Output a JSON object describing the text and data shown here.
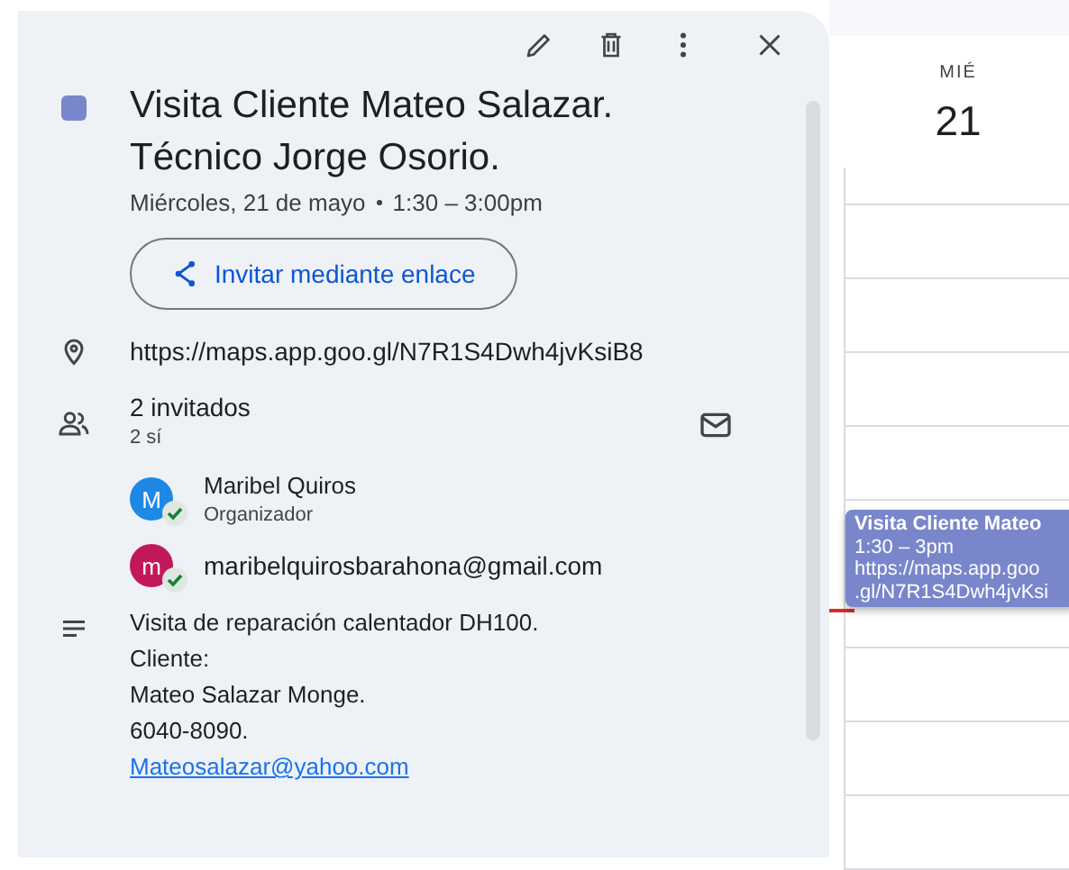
{
  "event": {
    "color": "#7986cb",
    "title_lines": [
      "Visita Cliente Mateo Salazar.",
      "Técnico Jorge Osorio."
    ],
    "date": "Miércoles, 21 de mayo",
    "time": "1:30 – 3:00pm",
    "invite_button": "Invitar mediante enlace",
    "location": "https://maps.app.goo.gl/N7R1S4Dwh4jvKsiB8",
    "guests_count": "2 invitados",
    "guests_yes": "2 sí",
    "guests": [
      {
        "avatar": "M",
        "color": "#1e88e5",
        "name": "Maribel Quiros",
        "role": "Organizador",
        "accepted": true
      },
      {
        "avatar": "m",
        "color": "#c2185b",
        "name": "maribelquirosbarahona@gmail.com",
        "accepted": true
      }
    ],
    "description": [
      "Visita de reparación calentador DH100.",
      "Cliente:",
      "Mateo Salazar Monge.",
      "6040-8090."
    ],
    "description_link": "Mateosalazar@yahoo.com"
  },
  "calendar": {
    "day_name": "MIÉ",
    "day_number": "21",
    "event_card": {
      "color": "#7986cb",
      "title": "Visita Cliente Mateo",
      "time": "1:30 – 3pm",
      "lines": [
        "https://maps.app.goo",
        ".gl/N7R1S4Dwh4jvKsi"
      ]
    }
  }
}
